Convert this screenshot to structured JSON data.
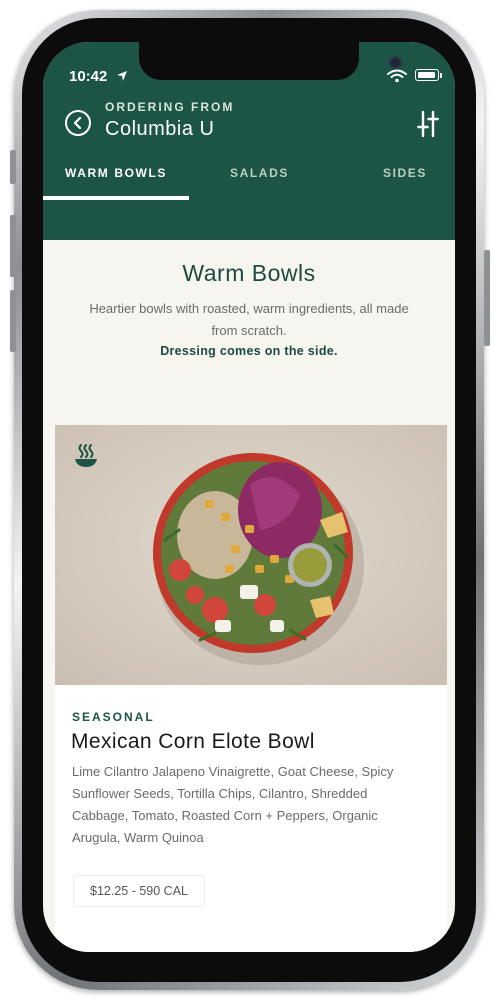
{
  "status_bar": {
    "time": "10:42"
  },
  "header": {
    "ordering_label": "ORDERING FROM",
    "location": "Columbia U"
  },
  "tabs": [
    {
      "label": "WARM BOWLS",
      "active": true
    },
    {
      "label": "SALADS",
      "active": false
    },
    {
      "label": "SIDES",
      "active": false
    }
  ],
  "section": {
    "title": "Warm Bowls",
    "description": "Heartier bowls with roasted, warm ingredients, all made from scratch.",
    "note": "Dressing comes on the side."
  },
  "item": {
    "tag": "SEASONAL",
    "name": "Mexican Corn Elote Bowl",
    "ingredients": "Lime Cilantro Jalapeno Vinaigrette, Goat Cheese, Spicy Sunflower Seeds, Tortilla Chips, Cilantro, Shredded Cabbage, Tomato, Roasted Corn + Peppers, Organic Arugula, Warm Quinoa",
    "price_cal": "$12.25 - 590 CAL"
  },
  "icons": {
    "back": "back-arrow-icon",
    "filter": "filter-sliders-icon",
    "warm": "warm-bowl-steam-icon"
  },
  "colors": {
    "brand_green": "#1c5545",
    "title_green": "#1c4b3d",
    "background": "#f7f5f0"
  }
}
